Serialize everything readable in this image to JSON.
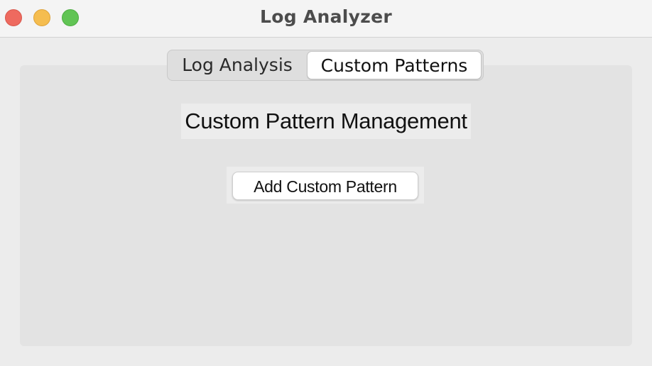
{
  "window": {
    "title": "Log Analyzer"
  },
  "tabs": [
    {
      "label": "Log Analysis",
      "selected": false
    },
    {
      "label": "Custom Patterns",
      "selected": true
    }
  ],
  "content": {
    "heading": "Custom Pattern Management",
    "add_button_label": "Add Custom Pattern"
  },
  "colors": {
    "close": "#ee6a5f",
    "minimize": "#f5bd4f",
    "zoom": "#61c454"
  }
}
